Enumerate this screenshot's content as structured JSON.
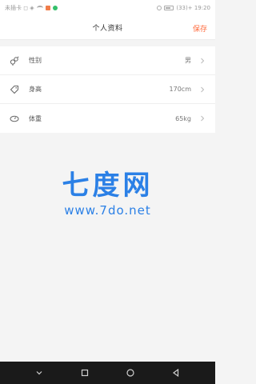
{
  "status_bar": {
    "left_text": "未插卡 ◻ ◈",
    "right_text": "(33)+ 19:20"
  },
  "header": {
    "title": "个人资料",
    "save_label": "保存"
  },
  "profile": {
    "items": [
      {
        "icon": "gender-icon",
        "label": "性别",
        "value": "男"
      },
      {
        "icon": "tag-icon",
        "label": "身高",
        "value": "170cm"
      },
      {
        "icon": "weight-icon",
        "label": "体重",
        "value": "65kg"
      }
    ]
  },
  "watermark": {
    "logo_text": "七度网",
    "url": "www.7do.net"
  },
  "system_nav": {
    "buttons": [
      "collapse-icon",
      "recents-icon",
      "home-icon",
      "back-icon"
    ]
  },
  "colors": {
    "accent": "#ff6b3d",
    "watermark": "#2b80e6",
    "nav_bar": "#1a1a1a"
  }
}
